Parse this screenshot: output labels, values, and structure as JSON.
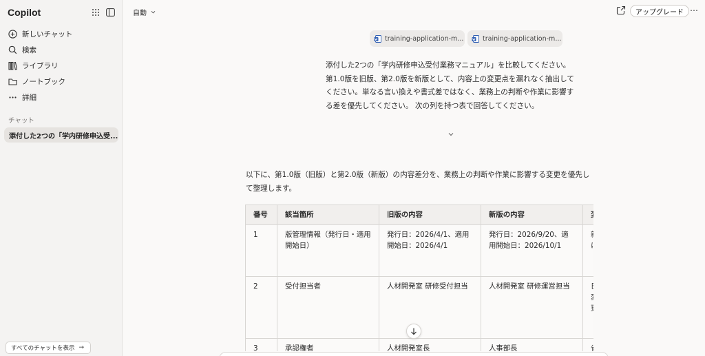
{
  "sidebar": {
    "brand": "Copilot",
    "nav": [
      {
        "icon": "plus-circle-icon",
        "label": "新しいチャット"
      },
      {
        "icon": "search-icon",
        "label": "検索"
      },
      {
        "icon": "library-icon",
        "label": "ライブラリ"
      },
      {
        "icon": "notebook-icon",
        "label": "ノートブック"
      },
      {
        "icon": "ellipsis-icon",
        "label": "詳細"
      }
    ],
    "section_label": "チャット",
    "active_chat": "添付した2つの「学内研修申込受...",
    "all_chats_label": "すべてのチャットを表示"
  },
  "topbar": {
    "mode": "自動",
    "upgrade": "アップグレード"
  },
  "attachments": [
    {
      "name": "training-application-m..."
    },
    {
      "name": "training-application-m..."
    }
  ],
  "user_message": "添付した2つの「学内研修申込受付業務マニュアル」を比較してください。 第1.0版を旧版、第2.0版を新版として、内容上の変更点を漏れなく抽出してください。単なる言い換えや書式差ではなく、業務上の判断や作業に影響する差を優先してください。 次の列を持つ表で回答してください。",
  "answer": {
    "intro": "以下に、第1.0版（旧版）と第2.0版（新版）の内容差分を、業務上の判断や作業に影響する変更を優先して整理します。",
    "columns": [
      "番号",
      "該当箇所",
      "旧版の内容",
      "新版の内容",
      "変"
    ],
    "rows": [
      {
        "no": "1",
        "section": "版管理情報（発行日・適用開始日）",
        "old": "発行日：2026/4/1、適用開始日：2026/4/1",
        "new": "発行日：2026/9/20、適用開始日：2026/10/1",
        "change": "新付に更"
      },
      {
        "no": "2",
        "section": "受付担当者",
        "old": "人材開発室 研修受付担当",
        "new": "人材開発室 研修運営担当",
        "change": "日分変連更"
      },
      {
        "no": "3",
        "section": "承認権者",
        "old": "人材開発室長",
        "new": "人事部長",
        "change": "省"
      }
    ]
  },
  "colors": {
    "sidebar_bg": "#f4f3f2",
    "main_bg": "#faf9f8",
    "active_item": "#e6e3e0",
    "doc_icon": "#2f5fb3"
  }
}
